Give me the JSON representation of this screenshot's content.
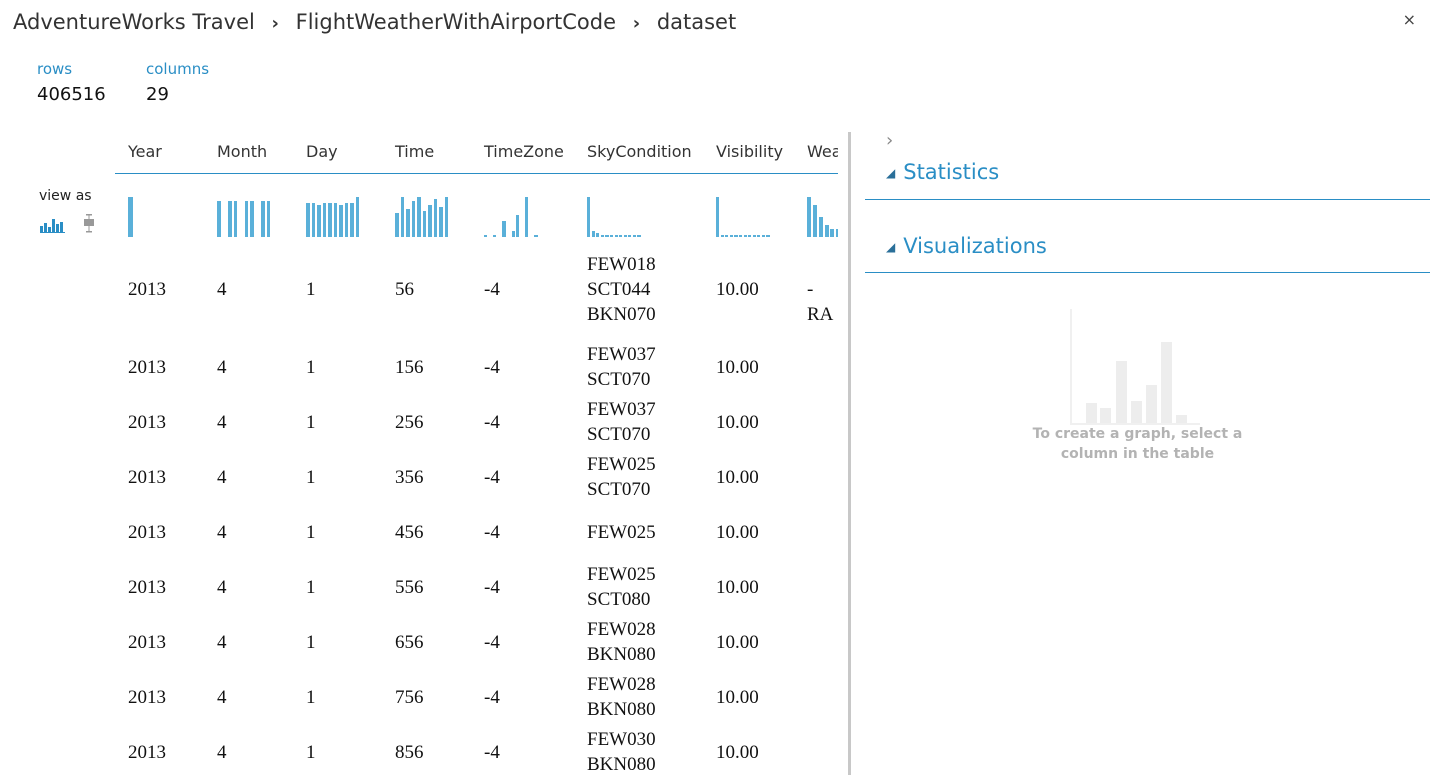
{
  "breadcrumb": [
    "AdventureWorks Travel",
    "FlightWeatherWithAirportCode",
    "dataset"
  ],
  "breadcrumb_separator": "›",
  "close_label": "×",
  "stats": {
    "rows_label": "rows",
    "rows_value": "406516",
    "columns_label": "columns",
    "columns_value": "29"
  },
  "view_as_label": "view as",
  "view_as_options": [
    "histogram-icon",
    "boxplot-icon"
  ],
  "columns": [
    "Year",
    "Month",
    "Day",
    "Time",
    "TimeZone",
    "SkyCondition",
    "Visibility",
    "Wea"
  ],
  "rows": [
    [
      "2013",
      "4",
      "1",
      "56",
      "-4",
      "FEW018\nSCT044\nBKN070",
      "10.00",
      "-RA"
    ],
    [
      "2013",
      "4",
      "1",
      "156",
      "-4",
      "FEW037\nSCT070",
      "10.00",
      ""
    ],
    [
      "2013",
      "4",
      "1",
      "256",
      "-4",
      "FEW037\nSCT070",
      "10.00",
      ""
    ],
    [
      "2013",
      "4",
      "1",
      "356",
      "-4",
      "FEW025\nSCT070",
      "10.00",
      ""
    ],
    [
      "2013",
      "4",
      "1",
      "456",
      "-4",
      "FEW025",
      "10.00",
      ""
    ],
    [
      "2013",
      "4",
      "1",
      "556",
      "-4",
      "FEW025\nSCT080",
      "10.00",
      ""
    ],
    [
      "2013",
      "4",
      "1",
      "656",
      "-4",
      "FEW028\nBKN080",
      "10.00",
      ""
    ],
    [
      "2013",
      "4",
      "1",
      "756",
      "-4",
      "FEW028\nBKN080",
      "10.00",
      ""
    ],
    [
      "2013",
      "4",
      "1",
      "856",
      "-4",
      "FEW030\nBKN080",
      "10.00",
      ""
    ]
  ],
  "histograms": [
    [
      1
    ],
    [
      0.9,
      0,
      0.9,
      0.9,
      0,
      0.9,
      0.9,
      0,
      0.9,
      0.9
    ],
    [
      0.85,
      0.85,
      0.8,
      0.85,
      0.85,
      0.85,
      0.8,
      0.85,
      0.85,
      1
    ],
    [
      0.6,
      1,
      0.7,
      0.9,
      1,
      0.65,
      0.8,
      0.95,
      0.75,
      1
    ],
    [
      0.05,
      0,
      0.05,
      0,
      0.4,
      0,
      0.15,
      0.55,
      0,
      1,
      0,
      0.05
    ],
    [
      1,
      0.15,
      0.1,
      0.05,
      0.05,
      0.05,
      0.05,
      0.05,
      0.05,
      0.05,
      0.05,
      0.05
    ],
    [
      1,
      0.05,
      0.05,
      0.05,
      0.05,
      0.05,
      0.05,
      0.05,
      0.05,
      0.05,
      0.05,
      0.05
    ],
    [
      1,
      0.8,
      0.5,
      0.3,
      0.2,
      0.2
    ]
  ],
  "side_panel": {
    "expand_icon": "›",
    "statistics_label": "Statistics",
    "visualizations_label": "Visualizations",
    "placeholder_text": "To create a graph, select a column in the table",
    "collapse_icon": "▲"
  },
  "colors": {
    "accent": "#2a8ec5",
    "histogram": "#5ab0d9"
  }
}
